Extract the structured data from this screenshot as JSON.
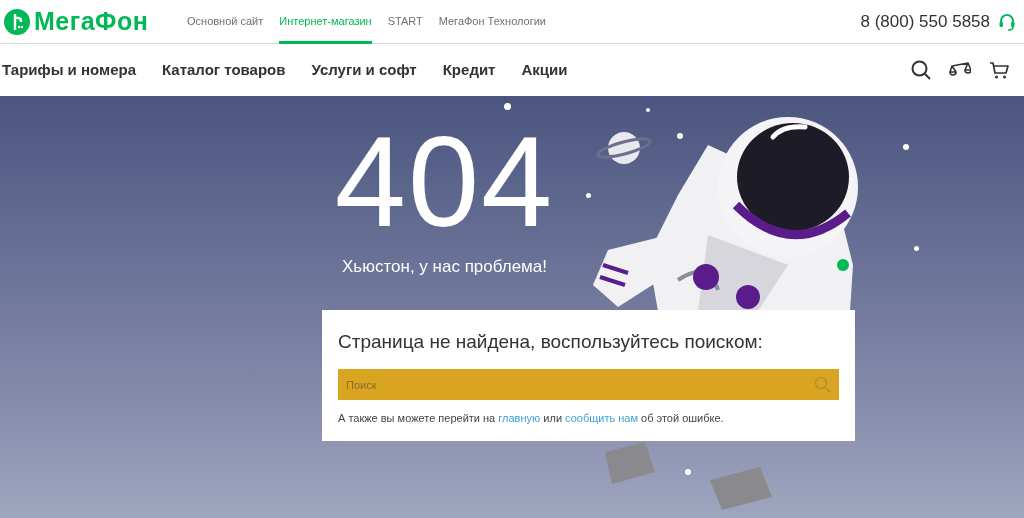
{
  "logo": {
    "text": "МегаФон"
  },
  "top_nav": [
    {
      "label": "Основной сайт",
      "selected": false
    },
    {
      "label": "Интернет-магазин",
      "selected": true
    },
    {
      "label": "START",
      "selected": false
    },
    {
      "label": "МегаФон Технологии",
      "selected": false
    }
  ],
  "phone": "8 (800) 550 5858",
  "main_nav": [
    "Тарифы и номера",
    "Каталог товаров",
    "Услуги и софт",
    "Кредит",
    "Акции"
  ],
  "error": {
    "code": "404",
    "subtitle": "Хьюстон, у нас проблема!"
  },
  "card": {
    "title": "Страница не найдена, воспользуйтесь поиском:",
    "search": {
      "placeholder": "Поиск"
    },
    "hint": {
      "text_before": "А также вы можете перейти на",
      "link_home": "главную",
      "text_middle": "или",
      "link_report": "сообщить нам",
      "text_after": "об этой ошибке."
    }
  }
}
